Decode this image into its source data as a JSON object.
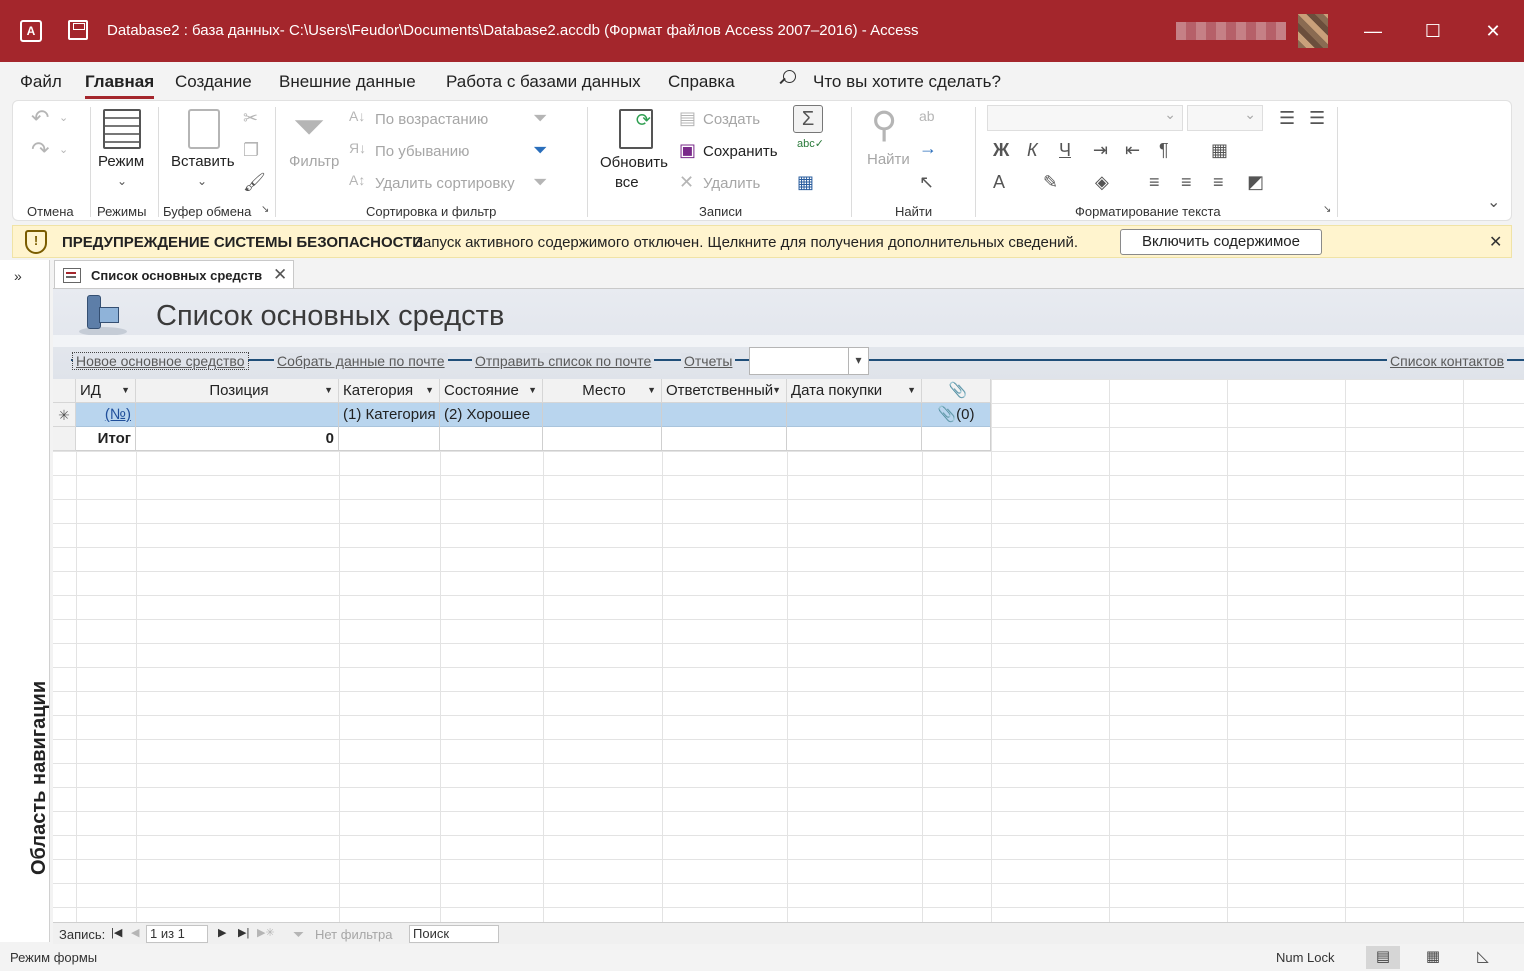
{
  "window": {
    "title": "Database2 : база данных- C:\\Users\\Feudor\\Documents\\Database2.accdb (Формат файлов Access 2007–2016)  -  Access",
    "minimize": "—",
    "maximize": "☐",
    "close": "✕"
  },
  "menu": {
    "items": [
      "Файл",
      "Главная",
      "Создание",
      "Внешние данные",
      "Работа с базами данных",
      "Справка"
    ],
    "tell_me": "Что вы хотите сделать?"
  },
  "ribbon": {
    "groups": {
      "undo": "Отмена",
      "views": "Режимы",
      "clipboard": "Буфер обмена",
      "sort_filter": "Сортировка и фильтр",
      "records": "Записи",
      "find": "Найти",
      "text_format": "Форматирование текста"
    },
    "view_button": "Режим",
    "paste_button": "Вставить",
    "filter_button": "Фильтр",
    "sort_asc": "По возрастанию",
    "sort_desc": "По убыванию",
    "remove_sort": "Удалить сортировку",
    "refresh_line1": "Обновить",
    "refresh_line2": "все",
    "new_record": "Создать",
    "save_record": "Сохранить",
    "delete_record": "Удалить",
    "find_button": "Найти",
    "bold": "Ж",
    "italic": "К",
    "underline": "Ч"
  },
  "security": {
    "title": "ПРЕДУПРЕЖДЕНИЕ СИСТЕМЫ БЕЗОПАСНОСТИ",
    "message": "Запуск активного содержимого отключен. Щелкните для получения дополнительных сведений.",
    "enable_button": "Включить содержимое",
    "close": "✕"
  },
  "nav_pane": {
    "label": "Область навигации",
    "expand": "»"
  },
  "document_tab": {
    "label": "Список основных средств",
    "close": "✕"
  },
  "form": {
    "title": "Список основных средств",
    "links": {
      "new_asset": "Новое основное средство",
      "collect_mail": "Собрать данные по почте",
      "send_list": "Отправить список по почте",
      "reports": "Отчеты",
      "contacts": "Список контактов"
    },
    "columns": [
      "ИД",
      "Позиция",
      "Категория",
      "Состояние",
      "Место",
      "Ответственный",
      "Дата покупки",
      "📎"
    ],
    "new_row": {
      "id": "(№)",
      "category": "(1) Категория",
      "condition": "(2) Хорошее",
      "attachment": "(0)"
    },
    "total_row": {
      "label": "Итог",
      "position_total": "0"
    }
  },
  "record_nav": {
    "label": "Запись:",
    "current": "1 из 1",
    "filter": "Нет фильтра",
    "search": "Поиск"
  },
  "status": {
    "mode": "Режим формы",
    "num_lock": "Num Lock"
  }
}
